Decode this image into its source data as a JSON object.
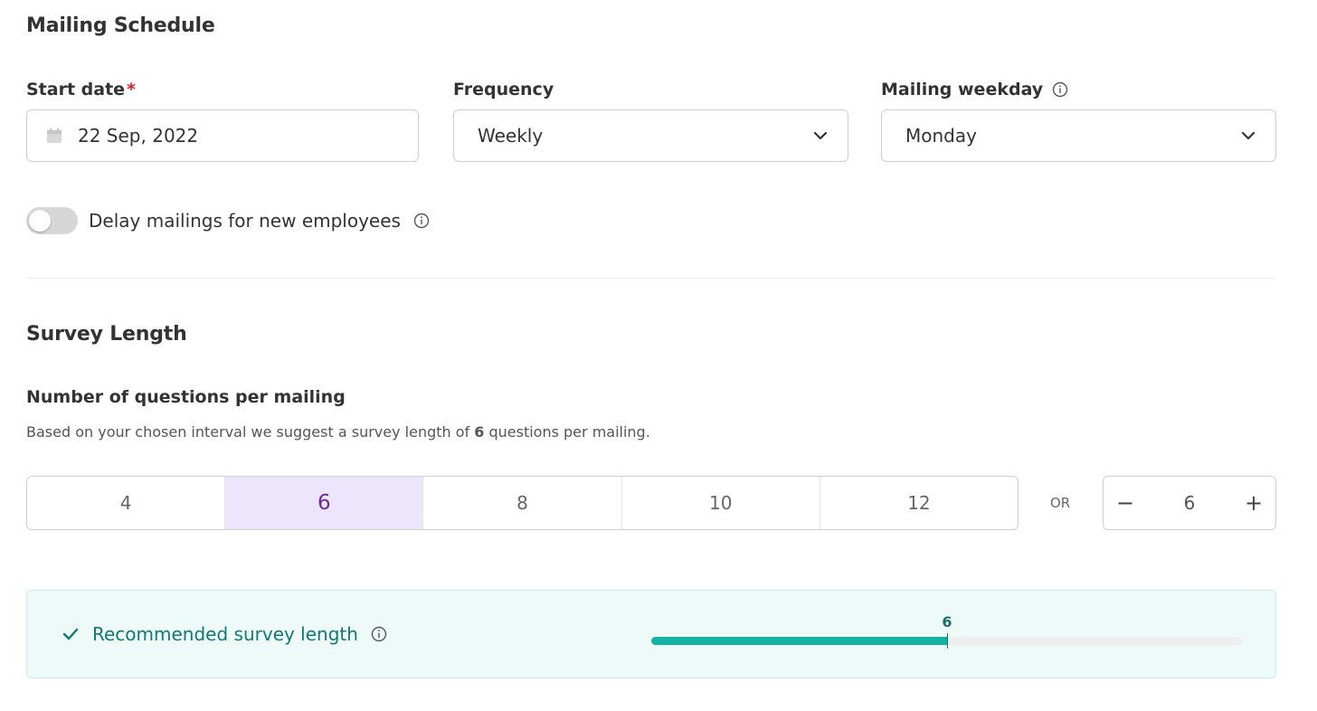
{
  "mailing_schedule": {
    "title": "Mailing Schedule",
    "start_date": {
      "label": "Start date",
      "required_mark": "*",
      "value": "22 Sep, 2022",
      "icon": "calendar-icon"
    },
    "frequency": {
      "label": "Frequency",
      "value": "Weekly",
      "icon": "chevron-down-icon"
    },
    "weekday": {
      "label": "Mailing weekday",
      "value": "Monday",
      "info_icon": "info-icon",
      "icon": "chevron-down-icon"
    },
    "delay": {
      "label": "Delay mailings for new employees",
      "enabled": false
    }
  },
  "survey_length": {
    "title": "Survey Length",
    "subtitle": "Number of questions per mailing",
    "hint_before": "Based on your chosen interval we suggest a survey length of ",
    "hint_value": "6",
    "hint_after": " questions per mailing.",
    "options": [
      "4",
      "6",
      "8",
      "10",
      "12"
    ],
    "selected": "6",
    "or_label": "OR",
    "stepper": {
      "minus": "−",
      "value": "6",
      "plus": "+"
    }
  },
  "recommendation": {
    "label": "Recommended survey length",
    "marker_label": "6",
    "fill_fraction": 0.5,
    "colors": {
      "fill": "#13b3a3",
      "text": "#117a70",
      "background": "#eefaf8"
    }
  }
}
